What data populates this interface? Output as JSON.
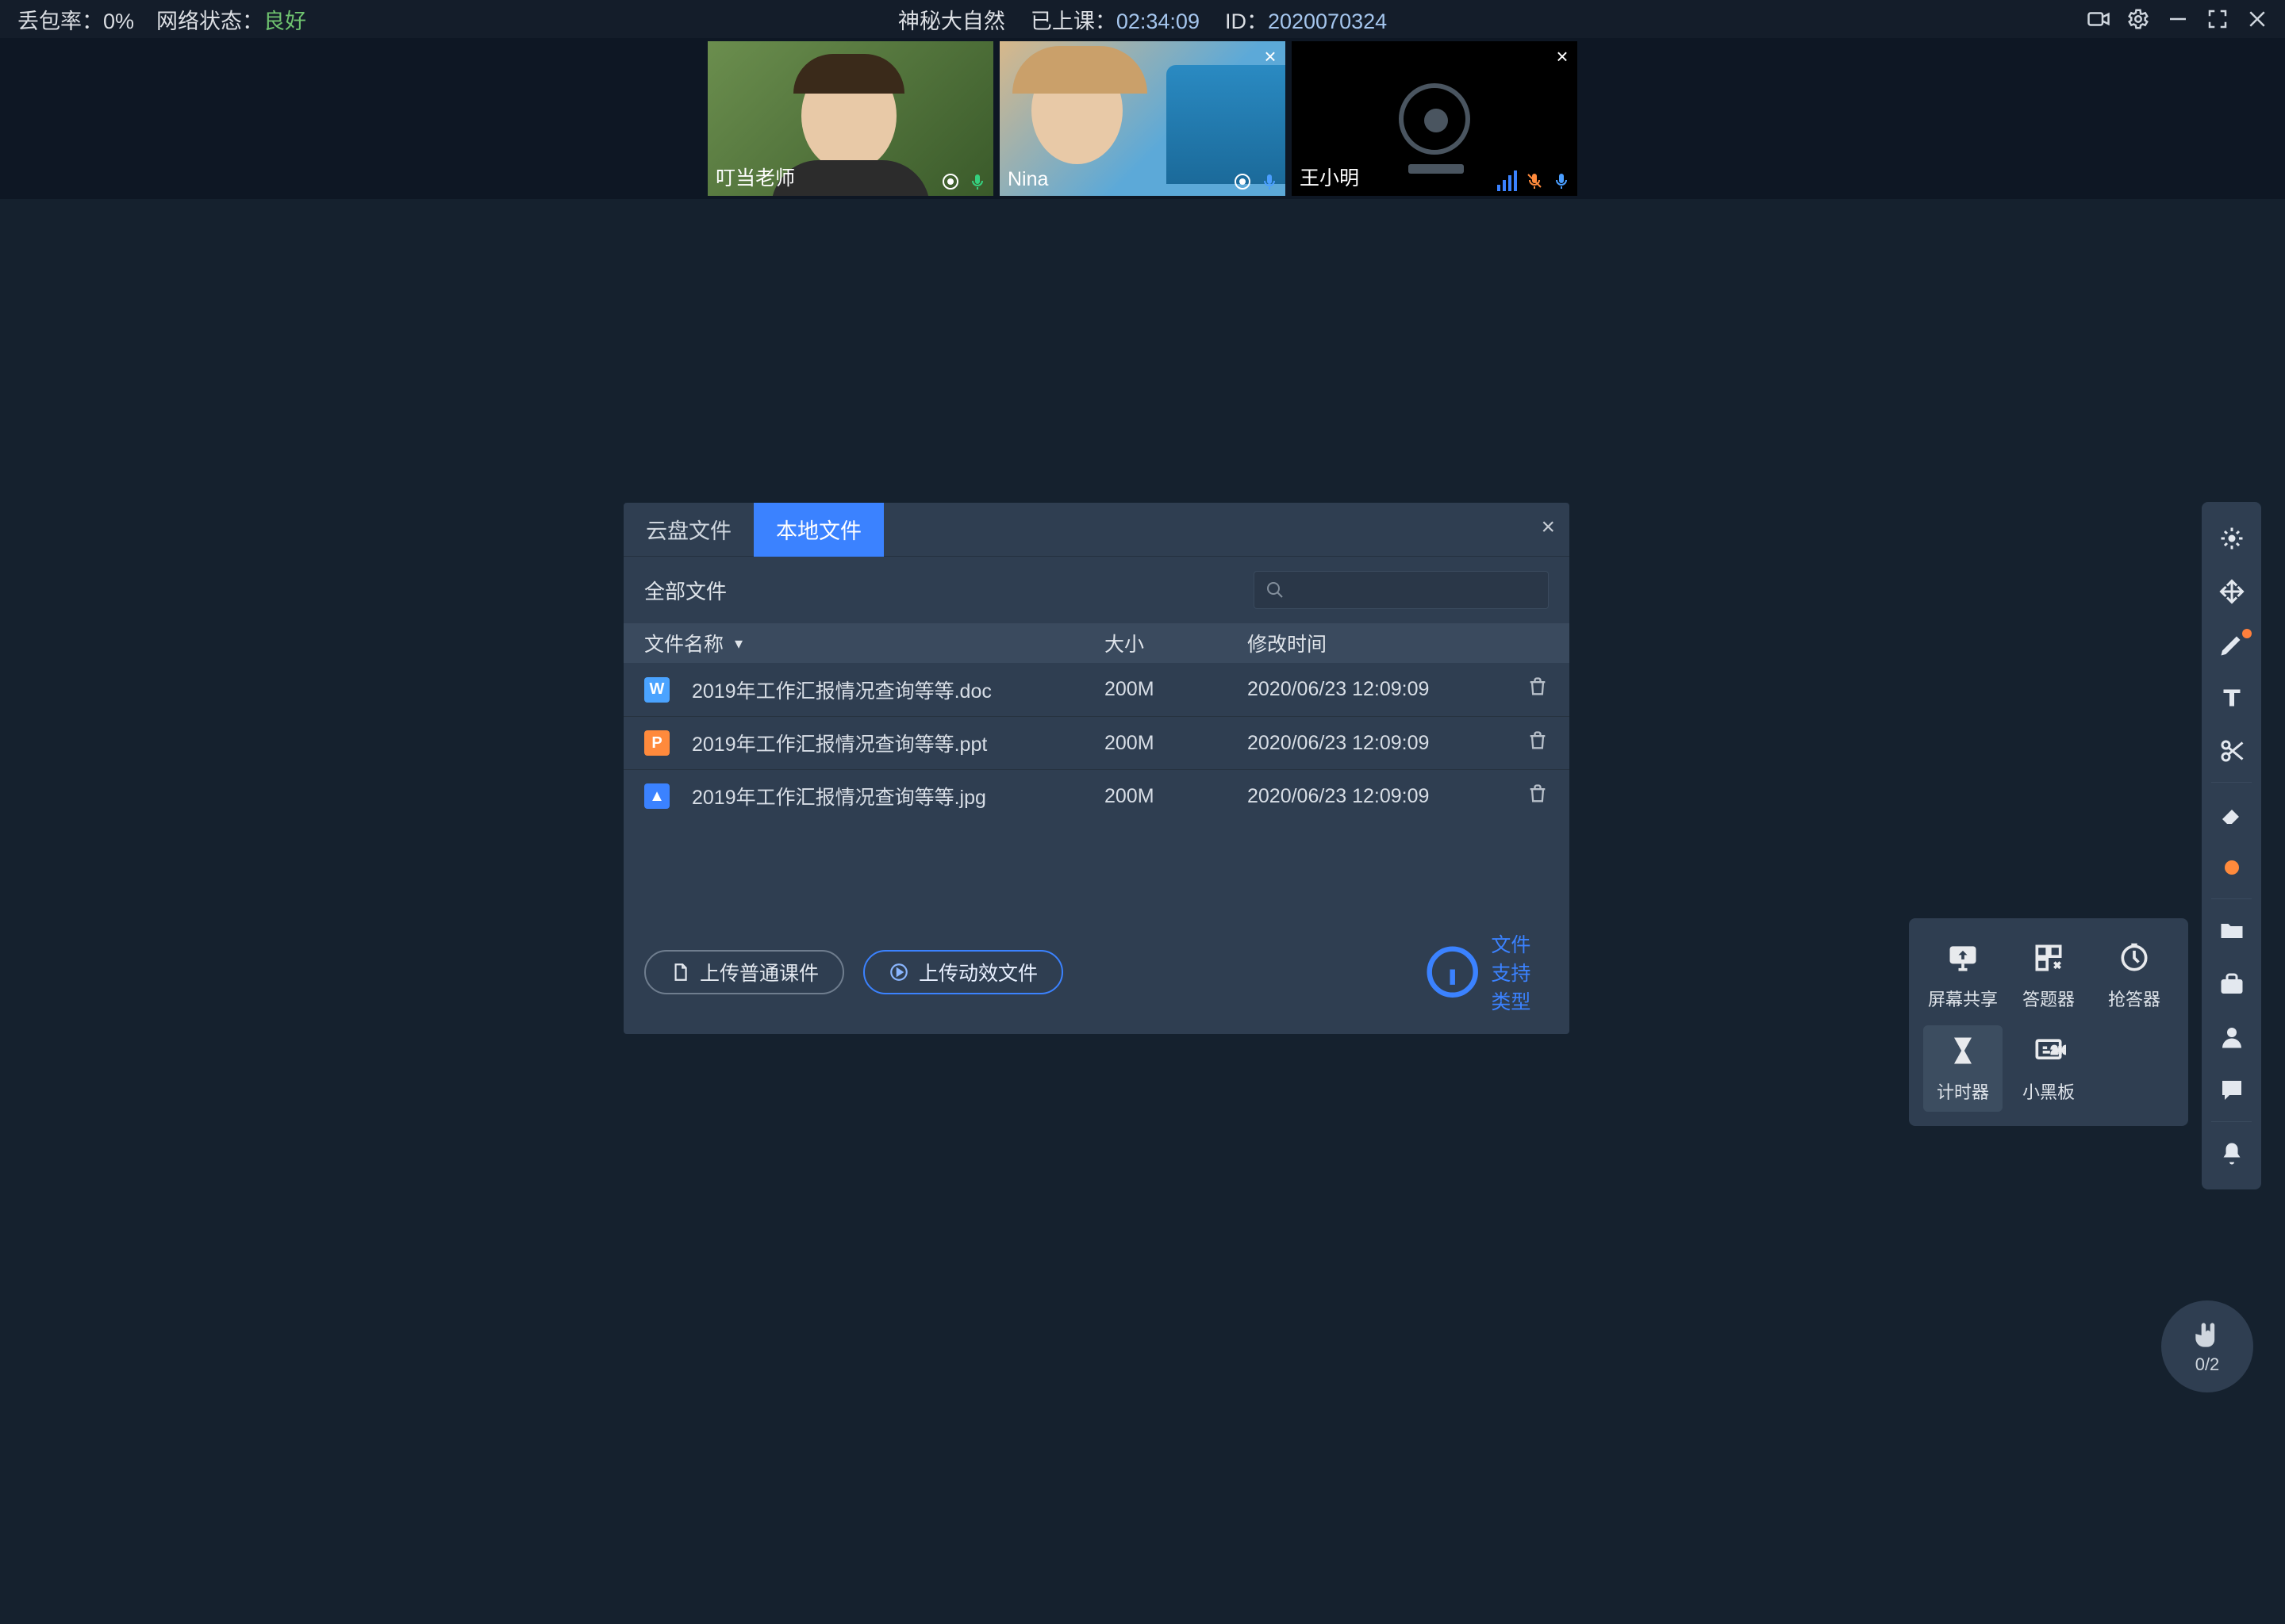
{
  "topbar": {
    "loss_label": "丢包率：",
    "loss_value": "0%",
    "net_label": "网络状态：",
    "net_value": "良好",
    "title": "神秘大自然",
    "lesson_label": "已上课：",
    "lesson_time": "02:34:09",
    "id_label": "ID：",
    "id_value": "2020070324"
  },
  "videos": [
    {
      "name": "叮当老师",
      "mic_muted": false,
      "closable": false
    },
    {
      "name": "Nina",
      "mic_muted": false,
      "closable": true
    },
    {
      "name": "王小明",
      "mic_muted": true,
      "closable": true
    }
  ],
  "modal": {
    "tabs": {
      "cloud": "云盘文件",
      "local": "本地文件",
      "active": "local"
    },
    "all_files_label": "全部文件",
    "headers": {
      "name": "文件名称",
      "size": "大小",
      "time": "修改时间"
    },
    "files": [
      {
        "icon": "doc",
        "name": "2019年工作汇报情况查询等等.doc",
        "size": "200M",
        "time": "2020/06/23 12:09:09"
      },
      {
        "icon": "ppt",
        "name": "2019年工作汇报情况查询等等.ppt",
        "size": "200M",
        "time": "2020/06/23 12:09:09"
      },
      {
        "icon": "jpg",
        "name": "2019年工作汇报情况查询等等.jpg",
        "size": "200M",
        "time": "2020/06/23 12:09:09"
      }
    ],
    "btn_upload_plain": "上传普通课件",
    "btn_upload_anim": "上传动效文件",
    "link_supported": "文件支持类型"
  },
  "tools": {
    "panel": [
      {
        "key": "screen-share",
        "label": "屏幕共享"
      },
      {
        "key": "answer",
        "label": "答题器"
      },
      {
        "key": "quick-answer",
        "label": "抢答器"
      },
      {
        "key": "timer",
        "label": "计时器",
        "selected": true
      },
      {
        "key": "blackboard",
        "label": "小黑板"
      }
    ]
  },
  "hand": {
    "count": "0/2"
  },
  "icon_letters": {
    "doc": "W",
    "ppt": "P",
    "jpg": "▲"
  }
}
